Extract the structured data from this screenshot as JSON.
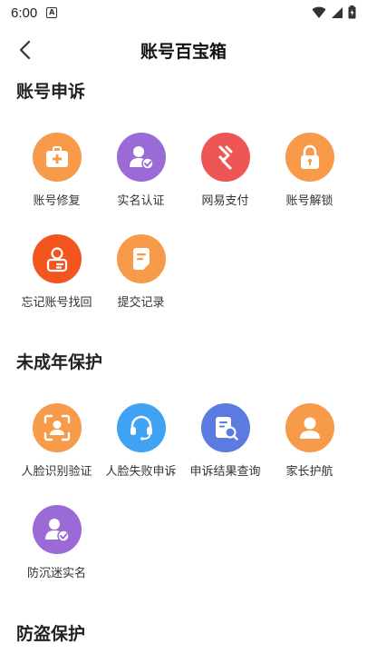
{
  "status_bar": {
    "time": "6:00",
    "notification_badge": "A"
  },
  "header": {
    "title": "账号百宝箱"
  },
  "sections": [
    {
      "title": "账号申诉",
      "items": [
        {
          "label": "账号修复",
          "icon": "first-aid-kit-icon",
          "color": "#F79B4A"
        },
        {
          "label": "实名认证",
          "icon": "user-verified-icon",
          "color": "#9A6BD6"
        },
        {
          "label": "网易支付",
          "icon": "netease-pay-icon",
          "color": "#EE5555"
        },
        {
          "label": "账号解锁",
          "icon": "unlock-icon",
          "color": "#F79B4A"
        },
        {
          "label": "忘记账号找回",
          "icon": "account-recovery-icon",
          "color": "#F2551E"
        },
        {
          "label": "提交记录",
          "icon": "document-icon",
          "color": "#F79B4A"
        }
      ]
    },
    {
      "title": "未成年保护",
      "items": [
        {
          "label": "人脸识别验证",
          "icon": "face-scan-icon",
          "color": "#F79B4A"
        },
        {
          "label": "人脸失败申诉",
          "icon": "headset-icon",
          "color": "#3FA2F2"
        },
        {
          "label": "申诉结果查询",
          "icon": "result-search-icon",
          "color": "#5B7BE0"
        },
        {
          "label": "家长护航",
          "icon": "parent-icon",
          "color": "#F79B4A"
        },
        {
          "label": "防沉迷实名",
          "icon": "anti-addiction-icon",
          "color": "#9A6BD6"
        }
      ]
    },
    {
      "title": "防盗保护",
      "items": []
    }
  ]
}
